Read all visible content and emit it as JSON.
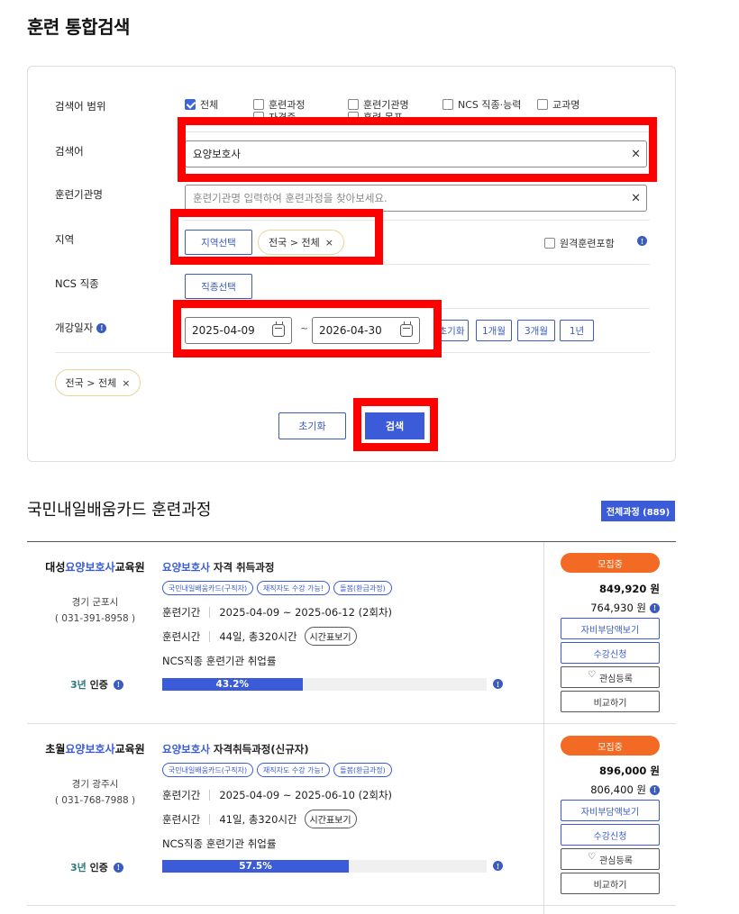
{
  "page_title": "훈련 통합검색",
  "search": {
    "scope_label": "검색어 범위",
    "scope_options": [
      {
        "label": "전체",
        "checked": true
      },
      {
        "label": "훈련과정",
        "checked": false
      },
      {
        "label": "훈련기관명",
        "checked": false
      },
      {
        "label": "NCS 직종·능력",
        "checked": false
      },
      {
        "label": "교과명",
        "checked": false
      },
      {
        "label": "자격증",
        "checked": false
      },
      {
        "label": "훈련 목표",
        "checked": false
      }
    ],
    "keyword_label": "검색어",
    "keyword_value": "요양보호사",
    "org_label": "훈련기관명",
    "org_placeholder": "훈련기관명 입력하여 훈련과정을 찾아보세요.",
    "region_label": "지역",
    "region_button": "지역선택",
    "region_chip": "전국 > 전체",
    "remote_label": "원격훈련포함",
    "ncs_label": "NCS 직종",
    "ncs_button": "직종선택",
    "date_label": "개강일자",
    "date_from": "2025-04-09",
    "date_to": "2026-04-30",
    "date_tilde": "~",
    "quick_ranges": [
      "초기화",
      "1개월",
      "3개월",
      "1년"
    ],
    "selected_chip": "전국 > 전체",
    "reset_button": "초기화",
    "search_button": "검색",
    "clear_icon": "×"
  },
  "results": {
    "section_title": "국민내일배움카드 훈련과정",
    "total_badge": "전체과정 (889)",
    "courses": [
      {
        "org_prefix": "대성",
        "org_highlight": "요양보호사",
        "org_suffix": "교육원",
        "org_location": "경기 군포시",
        "org_phone": "( 031-391-8958 )",
        "cert_years": "3년",
        "cert_label": "인증",
        "title_highlight": "요양보호사",
        "title_rest": " 자격 취득과정",
        "tags": [
          "국민내일배움카드(구직자)",
          "재직자도 수강 가능!",
          "돌봄(환급과정)"
        ],
        "period_label": "훈련기간",
        "period_value": "2025-04-09 ~ 2025-06-12 (2회차)",
        "hours_label": "훈련시간",
        "hours_value": "44일, 총320시간",
        "schedule_button": "시간표보기",
        "employment_label": "NCS직종 훈련기관 취업률",
        "employment_rate": "43.2%",
        "employment_fraction": 0.432,
        "status": "모집중",
        "price": "849,920 원",
        "self_pay": "764,930 원",
        "actions": [
          "자비부담액보기",
          "수강신청",
          "관심등록",
          "비교하기"
        ]
      },
      {
        "org_prefix": "초월",
        "org_highlight": "요양보호사",
        "org_suffix": "교육원",
        "org_location": "경기 광주시",
        "org_phone": "( 031-768-7988 )",
        "cert_years": "3년",
        "cert_label": "인증",
        "title_highlight": "요양보호사",
        "title_rest": " 자격취득과정(신규자)",
        "tags": [
          "국민내일배움카드(구직자)",
          "재직자도 수강 가능!",
          "돌봄(환급과정)"
        ],
        "period_label": "훈련기간",
        "period_value": "2025-04-09 ~ 2025-06-10 (2회차)",
        "hours_label": "훈련시간",
        "hours_value": "41일, 총320시간",
        "schedule_button": "시간표보기",
        "employment_label": "NCS직종 훈련기관 취업률",
        "employment_rate": "57.5%",
        "employment_fraction": 0.575,
        "status": "모집중",
        "price": "896,000 원",
        "self_pay": "806,400 원",
        "actions": [
          "자비부담액보기",
          "수강신청",
          "관심등록",
          "비교하기"
        ]
      }
    ]
  },
  "colors": {
    "accent": "#3b5bd8",
    "status": "#f26a24",
    "highlight_box": "#ff0000",
    "chip_border": "#e7d69a"
  }
}
